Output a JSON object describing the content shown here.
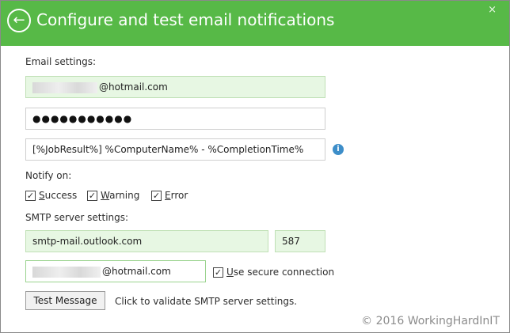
{
  "header": {
    "title": "Configure and test email notifications",
    "back_icon": "back-arrow-icon",
    "close_icon": "close-icon"
  },
  "email_settings": {
    "section_label": "Email settings:",
    "from_email_suffix": "@hotmail.com",
    "password_masked": "●●●●●●●●●●●",
    "subject_template": "[%JobResult%] %ComputerName% - %CompletionTime%",
    "info_icon": "info-icon"
  },
  "notify": {
    "label": "Notify on:",
    "options": [
      {
        "key": "S",
        "rest": "uccess",
        "checked": true
      },
      {
        "key": "W",
        "rest": "arning",
        "checked": true
      },
      {
        "key": "E",
        "rest": "rror",
        "checked": true
      }
    ]
  },
  "smtp": {
    "section_label": "SMTP server settings:",
    "server": "smtp-mail.outlook.com",
    "port": "587",
    "user_suffix": "@hotmail.com",
    "secure_key": "U",
    "secure_rest": "se secure connection",
    "secure_checked": true
  },
  "actions": {
    "test_button": "Test Message",
    "hint": "Click to validate SMTP server settings."
  },
  "watermark": "© 2016 WorkingHardInIT"
}
